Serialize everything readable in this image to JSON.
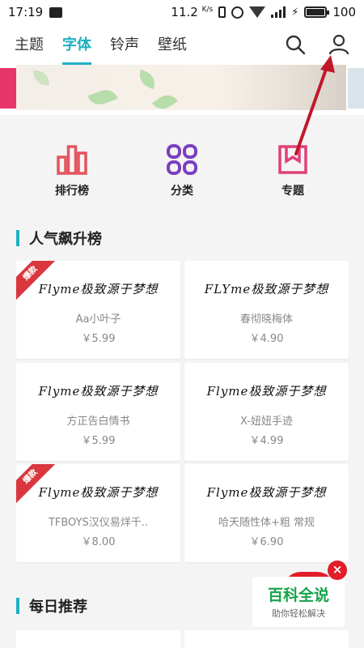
{
  "status_bar": {
    "time": "17:19",
    "speed": "11.2",
    "speed_unit": "K/s",
    "battery": "100"
  },
  "header": {
    "tabs": [
      {
        "label": "主题"
      },
      {
        "label": "字体"
      },
      {
        "label": "铃声"
      },
      {
        "label": "壁纸"
      }
    ],
    "active_tab": "字体",
    "accent": "#1fb0c2"
  },
  "categories": [
    {
      "label": "排行榜",
      "icon": "ranking-icon",
      "color": "#e4545e"
    },
    {
      "label": "分类",
      "icon": "category-icon",
      "color": "#7b3fbf"
    },
    {
      "label": "专题",
      "icon": "topic-icon",
      "color": "#e0407a"
    }
  ],
  "section_popular": {
    "title": "人气飙升榜"
  },
  "fonts": [
    {
      "preview": "Flyme极致源于梦想",
      "name": "Aa小叶子",
      "price": "￥5.99",
      "badge": "爆款"
    },
    {
      "preview": "FLYme极致源于梦想",
      "name": "春彻晓梅体",
      "price": "￥4.90",
      "badge": ""
    },
    {
      "preview": "Flyme极致源于梦想",
      "name": "方正告白情书",
      "price": "￥5.99",
      "badge": ""
    },
    {
      "preview": "Flyme极致源于梦想",
      "name": "X-妞妞手迹",
      "price": "￥4.99",
      "badge": ""
    },
    {
      "preview": "Flyme极致源于梦想",
      "name": "TFBOYS汉仪易烊千..",
      "price": "￥8.00",
      "badge": "爆款"
    },
    {
      "preview": "Flyme极致源于梦想",
      "name": "哈天随性体+粗 常规",
      "price": "￥6.90",
      "badge": ""
    }
  ],
  "section_daily": {
    "title": "每日推荐"
  },
  "watermark": {
    "title": "百科全说",
    "subtitle": "助你轻松解决",
    "close": "×"
  }
}
